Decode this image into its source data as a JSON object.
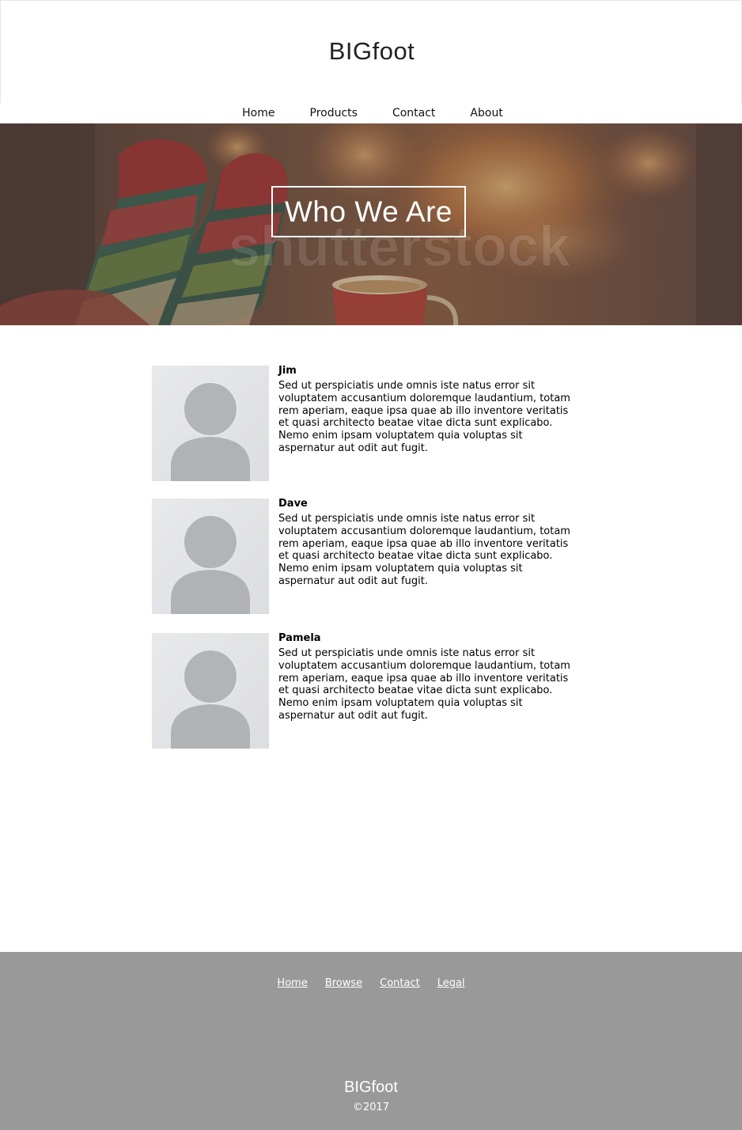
{
  "header": {
    "logo": "BIGfoot",
    "nav": [
      "Home",
      "Products",
      "Contact",
      "About"
    ]
  },
  "hero": {
    "title": "Who We Are",
    "watermark": "shutterstock"
  },
  "team": [
    {
      "name": "Jim",
      "bio": "Sed ut perspiciatis unde omnis iste natus error sit voluptatem accusantium doloremque laudantium, totam rem aperiam, eaque ipsa quae ab illo inventore veritatis et quasi architecto beatae vitae dicta sunt explicabo. Nemo enim ipsam voluptatem quia voluptas sit aspernatur aut odit aut fugit."
    },
    {
      "name": "Dave",
      "bio": "Sed ut perspiciatis unde omnis iste natus error sit voluptatem accusantium doloremque laudantium, totam rem aperiam, eaque ipsa quae ab illo inventore veritatis et quasi architecto beatae vitae dicta sunt explicabo. Nemo enim ipsam voluptatem quia voluptas sit aspernatur aut odit aut fugit."
    },
    {
      "name": "Pamela",
      "bio": "Sed ut perspiciatis unde omnis iste natus error sit voluptatem accusantium doloremque laudantium, totam rem aperiam, eaque ipsa quae ab illo inventore veritatis et quasi architecto beatae vitae dicta sunt explicabo. Nemo enim ipsam voluptatem quia voluptas sit aspernatur aut odit aut fugit."
    }
  ],
  "footer": {
    "links": [
      "Home",
      "Browse",
      "Contact",
      "Legal"
    ],
    "logo": "BIGfoot",
    "copyright": "©2017"
  },
  "colors": {
    "footer_bg": "#999999",
    "hero_overlay": "#5a4a45",
    "avatar_bg": "#e4e5e7",
    "avatar_figure": "#b3b4b7"
  },
  "icons": {
    "avatar": "avatar-placeholder-icon"
  }
}
